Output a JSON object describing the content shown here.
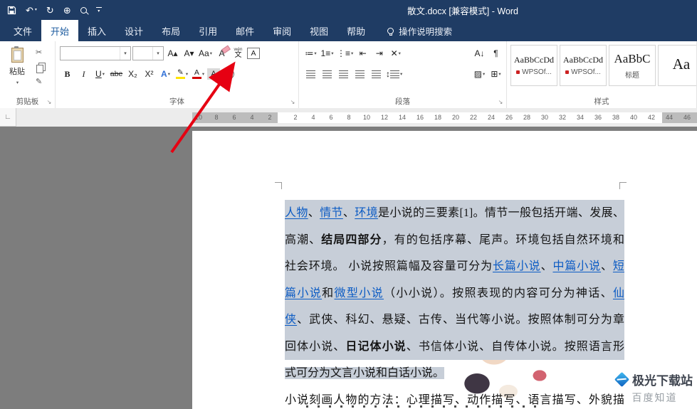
{
  "titlebar": {
    "title": "散文.docx [兼容模式] - Word"
  },
  "tabs": {
    "items": [
      {
        "label": "文件"
      },
      {
        "label": "开始",
        "active": true
      },
      {
        "label": "插入"
      },
      {
        "label": "设计"
      },
      {
        "label": "布局"
      },
      {
        "label": "引用"
      },
      {
        "label": "邮件"
      },
      {
        "label": "审阅"
      },
      {
        "label": "视图"
      },
      {
        "label": "帮助"
      }
    ],
    "search": "操作说明搜索"
  },
  "icons": {
    "caret": "▾",
    "undo": "↶",
    "redo": "↻",
    "touch": "⊕",
    "cut": "✂",
    "brush": "✎",
    "launcher": "↘",
    "grow": "A▴",
    "shrink": "A▾",
    "case": "Aa",
    "clear": "A",
    "pinyin_top": "wén",
    "pinyin_bottom": "文",
    "border_a": "A",
    "bold": "B",
    "italic": "I",
    "underline": "U",
    "strike": "abe",
    "sub": "X₂",
    "sup": "X²",
    "fx": "A",
    "pen": "✎",
    "fontcolor": "A",
    "shade_a": "A",
    "enclose": "字",
    "bullets": "≔",
    "numbering": "1≡",
    "multilevel": "⋮≡",
    "dec_indent": "⇤",
    "inc_indent": "⇥",
    "asian": "✕",
    "sort": "A↓",
    "pilcrow": "¶",
    "updown": "↕",
    "shading": "▨",
    "borders": "⊞",
    "tabstop": "∟"
  },
  "ribbon": {
    "clipboard": {
      "label": "剪贴板",
      "paste": "粘贴"
    },
    "font": {
      "label": "字体",
      "name_value": "",
      "size_value": ""
    },
    "paragraph": {
      "label": "段落"
    },
    "styles": {
      "label": "样式",
      "cards": [
        {
          "sample": "AaBbCcDd",
          "name": "WPSOf...",
          "size": "",
          "marked": true
        },
        {
          "sample": "AaBbCcDd",
          "name": "WPSOf...",
          "size": "",
          "marked": true
        },
        {
          "sample": "AaBbC",
          "name": "标题",
          "size": "big",
          "marked": false
        },
        {
          "sample": "Aa",
          "name": "",
          "size": "huge",
          "marked": false
        }
      ]
    }
  },
  "ruler": {
    "left_numbers": [
      "10",
      "8",
      "6",
      "4",
      "2"
    ],
    "right_numbers": [
      "2",
      "4",
      "6",
      "8",
      "10",
      "12",
      "14",
      "16",
      "18",
      "20",
      "22",
      "24",
      "26",
      "28",
      "30",
      "32",
      "34",
      "36",
      "38",
      "40",
      "42",
      "44",
      "46"
    ]
  },
  "document": {
    "lines": [
      {
        "selected": true,
        "full": true,
        "runs": [
          {
            "t": "人物",
            "s": "link"
          },
          {
            "t": "、"
          },
          {
            "t": "情节",
            "s": "link"
          },
          {
            "t": "、"
          },
          {
            "t": "环境",
            "s": "link"
          },
          {
            "t": "是小说的三要素[1]。情节一般包括开端、发展、"
          }
        ]
      },
      {
        "selected": true,
        "full": true,
        "runs": [
          {
            "t": "高潮、"
          },
          {
            "t": "结局四部分",
            "s": "bold"
          },
          {
            "t": "，有的包括序幕、尾声。环境包括自然环境和"
          }
        ]
      },
      {
        "selected": true,
        "full": true,
        "runs": [
          {
            "t": "社会环境。 小说按照篇幅及容量可分为"
          },
          {
            "t": "长篇小说",
            "s": "link"
          },
          {
            "t": "、"
          },
          {
            "t": "中篇小说",
            "s": "link"
          },
          {
            "t": "、"
          },
          {
            "t": "短",
            "s": "link"
          }
        ]
      },
      {
        "selected": true,
        "full": true,
        "runs": [
          {
            "t": "篇小说",
            "s": "link"
          },
          {
            "t": "和"
          },
          {
            "t": "微型小说",
            "s": "link"
          },
          {
            "t": "（小小说）。按照表现的内容可分为神话、"
          },
          {
            "t": "仙",
            "s": "link"
          }
        ]
      },
      {
        "selected": true,
        "full": true,
        "runs": [
          {
            "t": "侠",
            "s": "link"
          },
          {
            "t": "、武侠、科幻、悬疑、古传、当代等小说。按照体制可分为章"
          }
        ]
      },
      {
        "selected": true,
        "full": true,
        "runs": [
          {
            "t": "回体小说、"
          },
          {
            "t": "日记体小说",
            "s": "bold"
          },
          {
            "t": "、书信体小说、自传体小说。按照语言形"
          }
        ]
      },
      {
        "selected": false,
        "full": false,
        "runs": [
          {
            "t": "式可分为文言小说和白话小说。",
            "s": "hl"
          }
        ]
      },
      {
        "selected": false,
        "full": true,
        "runs": [
          {
            "t": "小说刻画人物的方法：心理描写、动作描写、语言描写、外貌描"
          }
        ]
      }
    ]
  },
  "watermark": {
    "line1": "极光下载站",
    "line2": "百度知道"
  }
}
